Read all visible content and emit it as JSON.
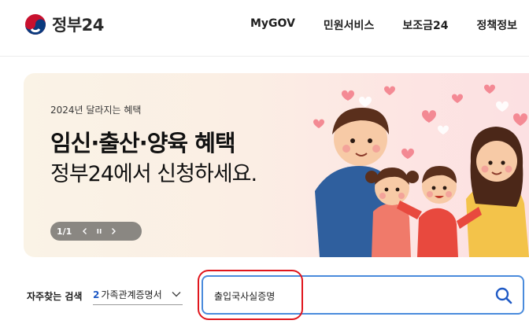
{
  "header": {
    "logo_text": "정부24",
    "nav": [
      {
        "label": "MyGOV"
      },
      {
        "label": "민원서비스"
      },
      {
        "label": "보조금24"
      },
      {
        "label": "정책정보"
      }
    ]
  },
  "banner": {
    "kicker": "2024년 달라지는 혜택",
    "title": "임신·출산·양육 혜택",
    "subtitle": "정부24에서 신청하세요.",
    "pager": {
      "count": "1/1"
    }
  },
  "search": {
    "quick_label": "자주찾는 검색",
    "quick_num": "2",
    "quick_text": "가족관계증명서",
    "query": "출입국사실증명"
  },
  "colors": {
    "accent": "#1e59c5",
    "search_border": "#4a8bdc",
    "highlight": "#e0161d"
  }
}
